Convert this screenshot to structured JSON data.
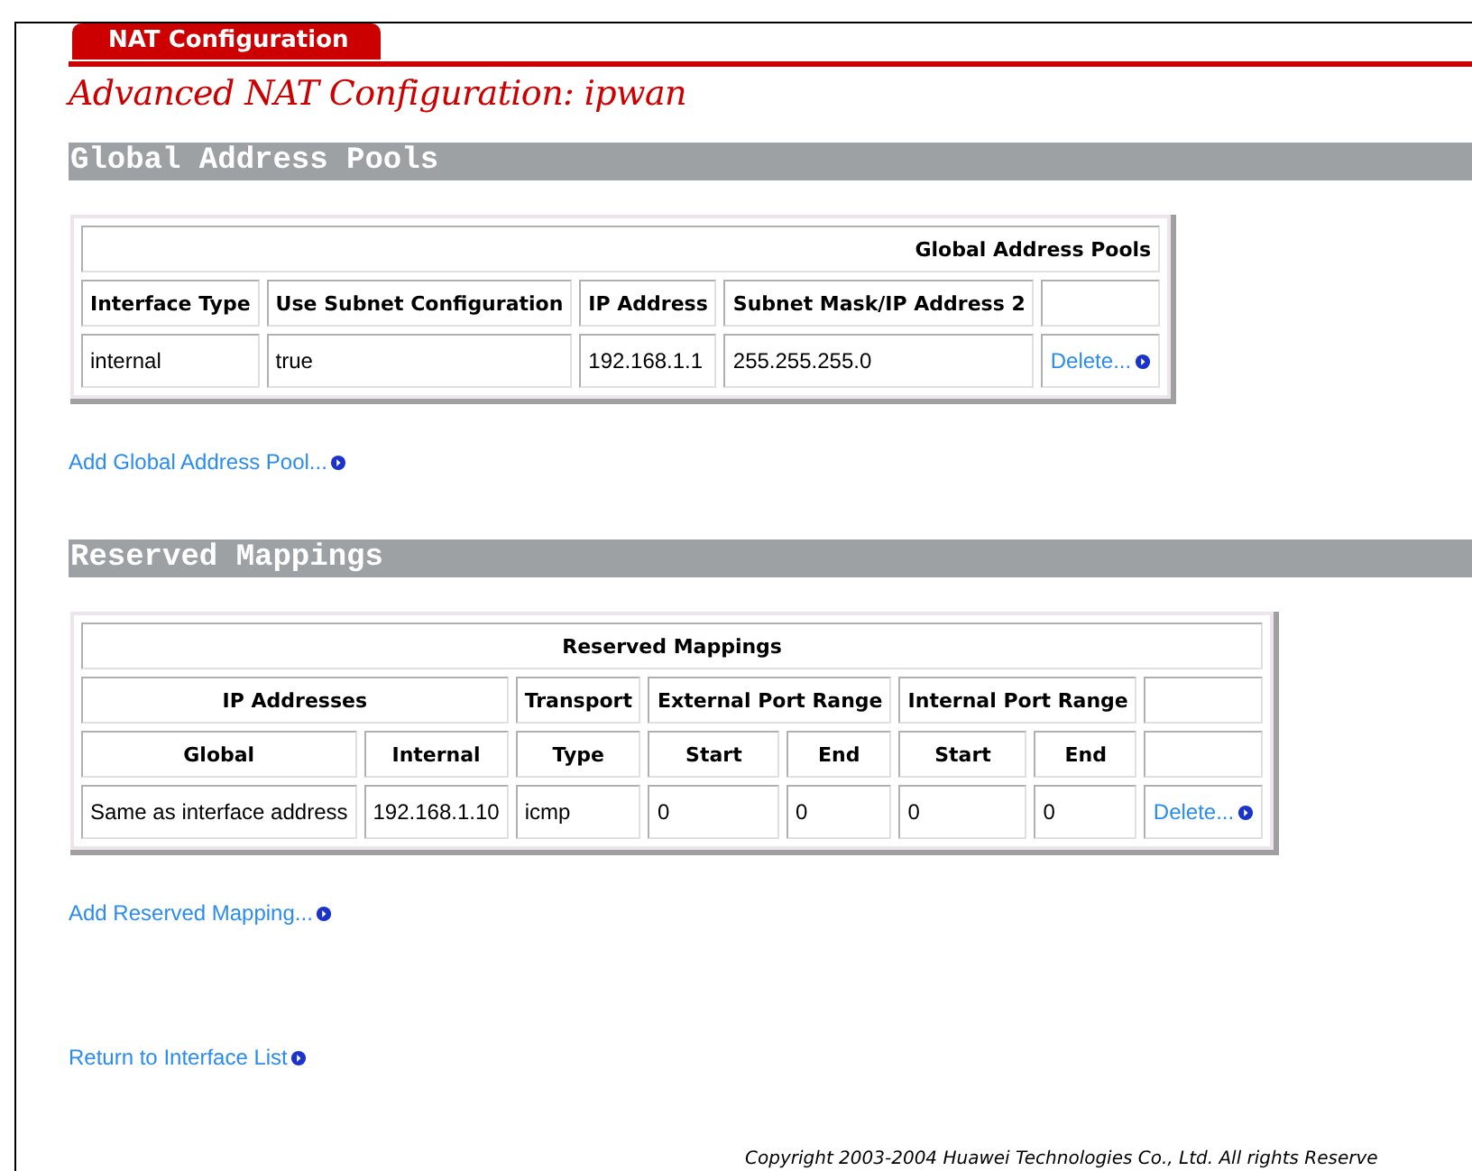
{
  "tab": {
    "label": "NAT Configuration",
    "selected": true
  },
  "page_title": "Advanced NAT Configuration: ipwan",
  "global_pools": {
    "section_title": "Global Address Pools",
    "table": {
      "title": "Global Address Pools",
      "columns": [
        "Interface Type",
        "Use Subnet Configuration",
        "IP Address",
        "Subnet Mask/IP Address 2"
      ],
      "rows": [
        {
          "cells": [
            "internal",
            "true",
            "192.168.1.1",
            "255.255.255.0"
          ],
          "action": "Delete..."
        }
      ]
    },
    "add_link": "Add Global Address Pool..."
  },
  "reserved_mappings": {
    "section_title": "Reserved Mappings",
    "table": {
      "title": "Reserved Mappings",
      "column_groups": [
        "IP Addresses",
        "Transport",
        "External Port Range",
        "Internal Port Range"
      ],
      "columns": [
        "Global",
        "Internal",
        "Type",
        "Start",
        "End",
        "Start",
        "End"
      ],
      "rows": [
        {
          "cells": [
            "Same as interface address",
            "192.168.1.10",
            "icmp",
            "0",
            "0",
            "0",
            "0"
          ],
          "action": "Delete..."
        }
      ]
    },
    "add_link": "Add Reserved Mapping..."
  },
  "return_link": "Return to Interface List",
  "footer": "Copyright 2003-2004 Huawei Technologies Co., Ltd. All rights Reserve"
}
